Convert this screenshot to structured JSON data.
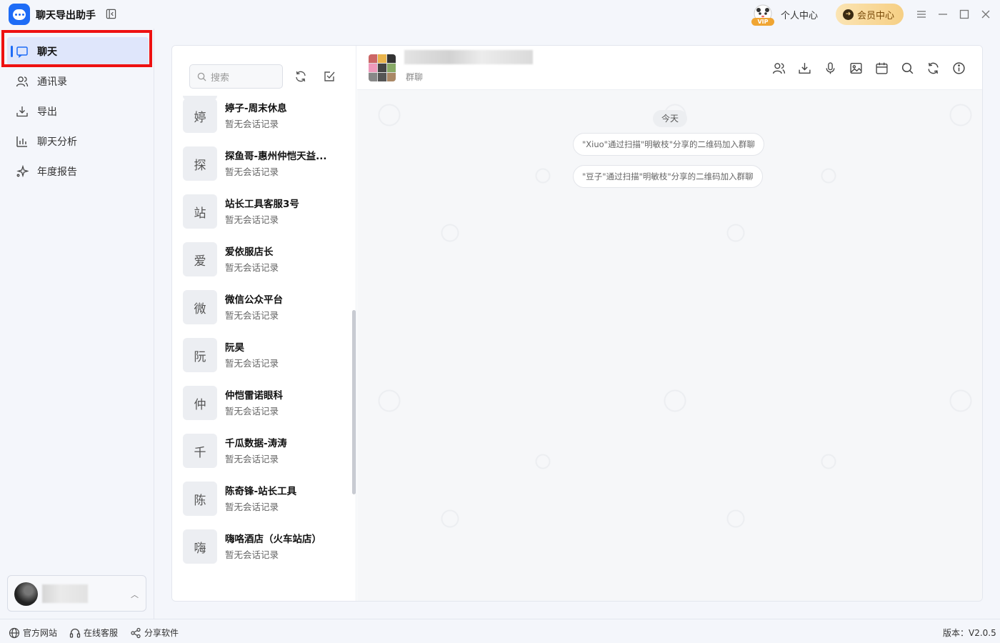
{
  "app": {
    "title": "聊天导出助手",
    "personal_center": "个人中心",
    "member_center": "会员中心",
    "vip_badge": "VIP"
  },
  "sidebar": {
    "items": [
      {
        "label": "聊天",
        "icon": "chat-icon",
        "active": true
      },
      {
        "label": "通讯录",
        "icon": "contacts-icon"
      },
      {
        "label": "导出",
        "icon": "export-icon"
      },
      {
        "label": "聊天分析",
        "icon": "bar-chart-icon"
      },
      {
        "label": "年度报告",
        "icon": "sparkle-icon"
      }
    ]
  },
  "search": {
    "placeholder": "搜索"
  },
  "contacts": [
    {
      "initial": "婷",
      "name": "婷子-周末休息",
      "sub": "暂无会话记录"
    },
    {
      "initial": "探",
      "name": "探鱼哥-惠州仲恺天益...",
      "sub": "暂无会话记录"
    },
    {
      "initial": "站",
      "name": "站长工具客服3号",
      "sub": "暂无会话记录"
    },
    {
      "initial": "爱",
      "name": "爱依服店长",
      "sub": "暂无会话记录"
    },
    {
      "initial": "微",
      "name": "微信公众平台",
      "sub": "暂无会话记录"
    },
    {
      "initial": "阮",
      "name": "阮昊",
      "sub": "暂无会话记录"
    },
    {
      "initial": "仲",
      "name": "仲恺雷诺眼科",
      "sub": "暂无会话记录"
    },
    {
      "initial": "千",
      "name": "千瓜数据-涛涛",
      "sub": "暂无会话记录"
    },
    {
      "initial": "陈",
      "name": "陈奇锋-站长工具",
      "sub": "暂无会话记录"
    },
    {
      "initial": "嗨",
      "name": "嗨咯酒店（火车站店）",
      "sub": "暂无会话记录"
    }
  ],
  "chat": {
    "group_type": "群聊",
    "date_label": "今天",
    "messages": [
      "\"Xiuo\"通过扫描\"明敏枝\"分享的二维码加入群聊",
      "\"豆子\"通过扫描\"明敏枝\"分享的二维码加入群聊"
    ]
  },
  "statusbar": {
    "website": "官方网站",
    "support": "在线客服",
    "share": "分享软件",
    "version": "版本：V2.0.5"
  },
  "colors": {
    "accent": "#1e6cf6",
    "highlight": "#e11111",
    "member_gold": "#f6cf84"
  }
}
